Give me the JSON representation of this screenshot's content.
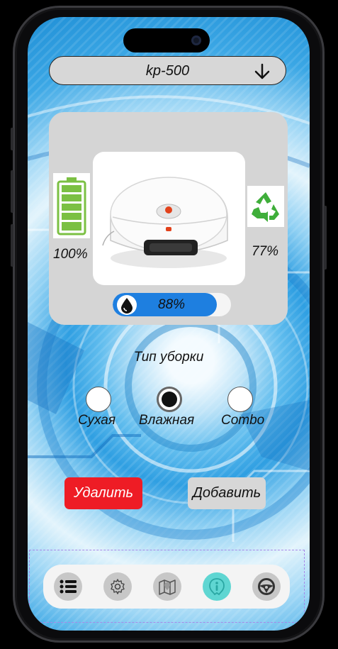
{
  "model_select": {
    "value": "kp-500",
    "icon": "arrow-down-icon"
  },
  "status": {
    "battery": {
      "percent": 100,
      "label": "100%",
      "icon": "battery-icon"
    },
    "robot_image": "robot-vacuum-image",
    "waste_bin": {
      "percent": 77,
      "label": "77%",
      "icon": "recycle-icon"
    },
    "water": {
      "percent": 88,
      "label": "88%",
      "icon": "water-drop-icon"
    }
  },
  "cleaning": {
    "title": "Тип уборки",
    "modes": [
      {
        "label": "Сухая",
        "selected": false
      },
      {
        "label": "Влажная",
        "selected": true
      },
      {
        "label": "Combo",
        "selected": false
      }
    ]
  },
  "actions": {
    "delete_label": "Удалить",
    "add_label": "Добавить"
  },
  "nav": {
    "items": [
      {
        "icon": "list-icon",
        "active": false
      },
      {
        "icon": "gear-icon",
        "active": false
      },
      {
        "icon": "map-icon",
        "active": false
      },
      {
        "icon": "info-icon",
        "active": true
      },
      {
        "icon": "steering-wheel-icon",
        "active": false
      }
    ]
  },
  "colors": {
    "delete": "#ee1c25",
    "water_fill": "#1e7fe0",
    "battery": "#7bc043",
    "recycle": "#3fae3a",
    "nav_active": "#5fd6d2"
  }
}
